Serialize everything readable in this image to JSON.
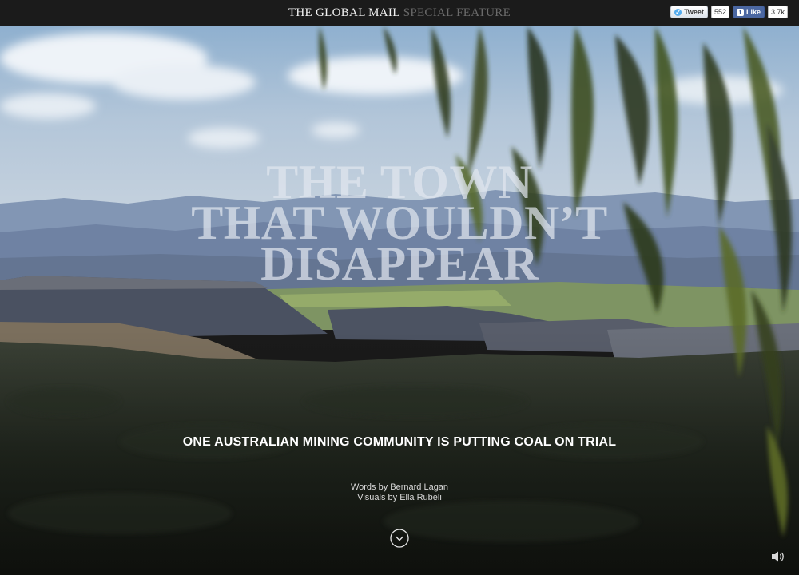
{
  "header": {
    "brand_name": "THE GLOBAL MAIL",
    "brand_feature": "SPECIAL FEATURE",
    "tweet_label": "Tweet",
    "tweet_count": "552",
    "like_label": "Like",
    "like_count": "3.7k"
  },
  "hero": {
    "headline_lines": [
      "THE TOWN",
      "THAT WOULDN’T",
      "DISAPPEAR"
    ],
    "subtitle": "ONE AUSTRALIAN MINING COMMUNITY IS PUTTING COAL ON TRIAL",
    "credits": [
      "Words by Bernard Lagan",
      "Visuals by Ella Rubeli"
    ]
  },
  "icons": {
    "scroll": "chevron-down-circle-icon",
    "sound": "speaker-icon",
    "twitter": "twitter-bird-icon",
    "facebook": "facebook-f-icon"
  },
  "colors": {
    "topbar": "#1b1b1b",
    "twitter": "#55acee",
    "facebook": "#3b5998"
  }
}
